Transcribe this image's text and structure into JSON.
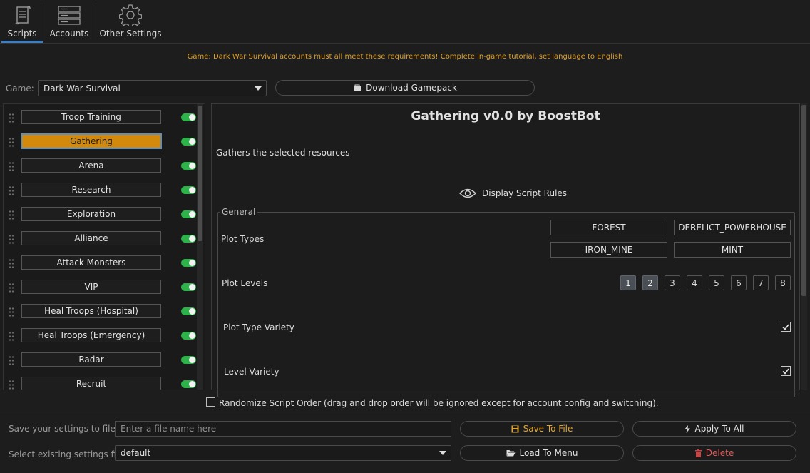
{
  "tabs": [
    {
      "label": "Scripts",
      "icon": "scroll-icon",
      "active": true
    },
    {
      "label": "Accounts",
      "icon": "server-icon",
      "active": false
    },
    {
      "label": "Other Settings",
      "icon": "gear-icon",
      "active": false
    }
  ],
  "notice": "Game: Dark War Survival accounts must all meet these requirements! Complete in-game tutorial, set language to English",
  "game": {
    "label": "Game:",
    "selected": "Dark War Survival",
    "download_label": "Download Gamepack"
  },
  "scripts": [
    {
      "label": "Troop Training",
      "enabled": true,
      "active": false
    },
    {
      "label": "Gathering",
      "enabled": true,
      "active": true
    },
    {
      "label": "Arena",
      "enabled": true,
      "active": false
    },
    {
      "label": "Research",
      "enabled": true,
      "active": false
    },
    {
      "label": "Exploration",
      "enabled": true,
      "active": false
    },
    {
      "label": "Alliance",
      "enabled": true,
      "active": false
    },
    {
      "label": "Attack Monsters",
      "enabled": true,
      "active": false
    },
    {
      "label": "VIP",
      "enabled": true,
      "active": false
    },
    {
      "label": "Heal Troops (Hospital)",
      "enabled": true,
      "active": false
    },
    {
      "label": "Heal Troops (Emergency)",
      "enabled": true,
      "active": false
    },
    {
      "label": "Radar",
      "enabled": true,
      "active": false
    },
    {
      "label": "Recruit",
      "enabled": true,
      "active": false
    }
  ],
  "detail": {
    "title": "Gathering v0.0 by BoostBot",
    "description": "Gathers the selected resources",
    "rules_label": "Display Script Rules",
    "group_title": "General",
    "plot_types_label": "Plot Types",
    "plot_types": [
      "FOREST",
      "DERELICT_POWERHOUSE",
      "IRON_MINE",
      "MINT"
    ],
    "plot_levels_label": "Plot Levels",
    "plot_levels": [
      {
        "label": "1",
        "selected": true
      },
      {
        "label": "2",
        "selected": true
      },
      {
        "label": "3",
        "selected": false
      },
      {
        "label": "4",
        "selected": false
      },
      {
        "label": "5",
        "selected": false
      },
      {
        "label": "6",
        "selected": false
      },
      {
        "label": "7",
        "selected": false
      },
      {
        "label": "8",
        "selected": false
      }
    ],
    "plot_type_variety_label": "Plot Type Variety",
    "plot_type_variety_checked": true,
    "level_variety_label": "Level Variety",
    "level_variety_checked": true
  },
  "randomize": {
    "label": "Randomize Script Order (drag and drop order will be ignored except for account config and switching).",
    "checked": false
  },
  "settings": {
    "save_label": "Save your settings to file",
    "file_placeholder": "Enter a file name here",
    "save_button": "Save To File",
    "apply_button": "Apply To All",
    "select_label": "Select existing settings file",
    "selected_file": "default",
    "load_button": "Load To Menu",
    "delete_button": "Delete"
  },
  "colors": {
    "accent": "#3d7fc1",
    "active_script": "#d38a0c",
    "toggle_on": "#2eb34a",
    "notice": "#e0a028",
    "delete": "#e05858"
  }
}
